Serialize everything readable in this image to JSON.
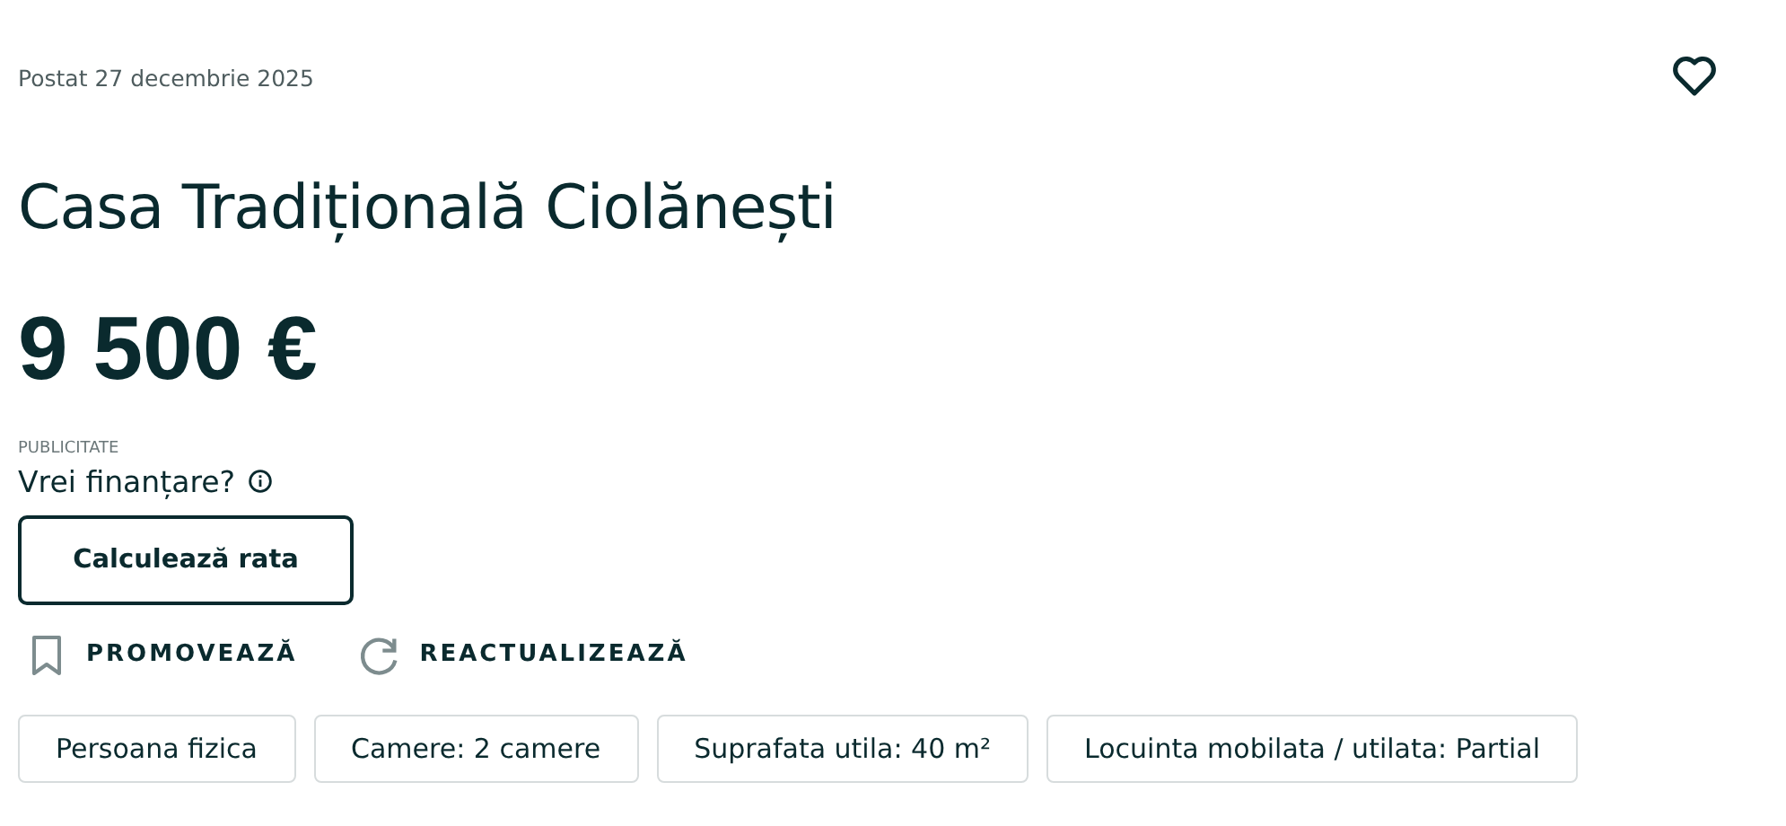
{
  "posted": "Postat 27 decembrie 2025",
  "favorite": {
    "selected": false
  },
  "title": "Casa Tradițională Ciolănești",
  "price": "9 500 €",
  "ad_label": "PUBLICITATE",
  "financing": {
    "question": "Vrei finanțare?",
    "button": "Calculează rata"
  },
  "actions": [
    {
      "kind": "promote",
      "label": "PROMOVEAZĂ"
    },
    {
      "kind": "refresh",
      "label": "REACTUALIZEAZĂ"
    }
  ],
  "tags": [
    "Persoana fizica",
    "Camere: 2 camere",
    "Suprafata utila: 40 m²",
    "Locuinta mobilata / utilata: Partial"
  ]
}
